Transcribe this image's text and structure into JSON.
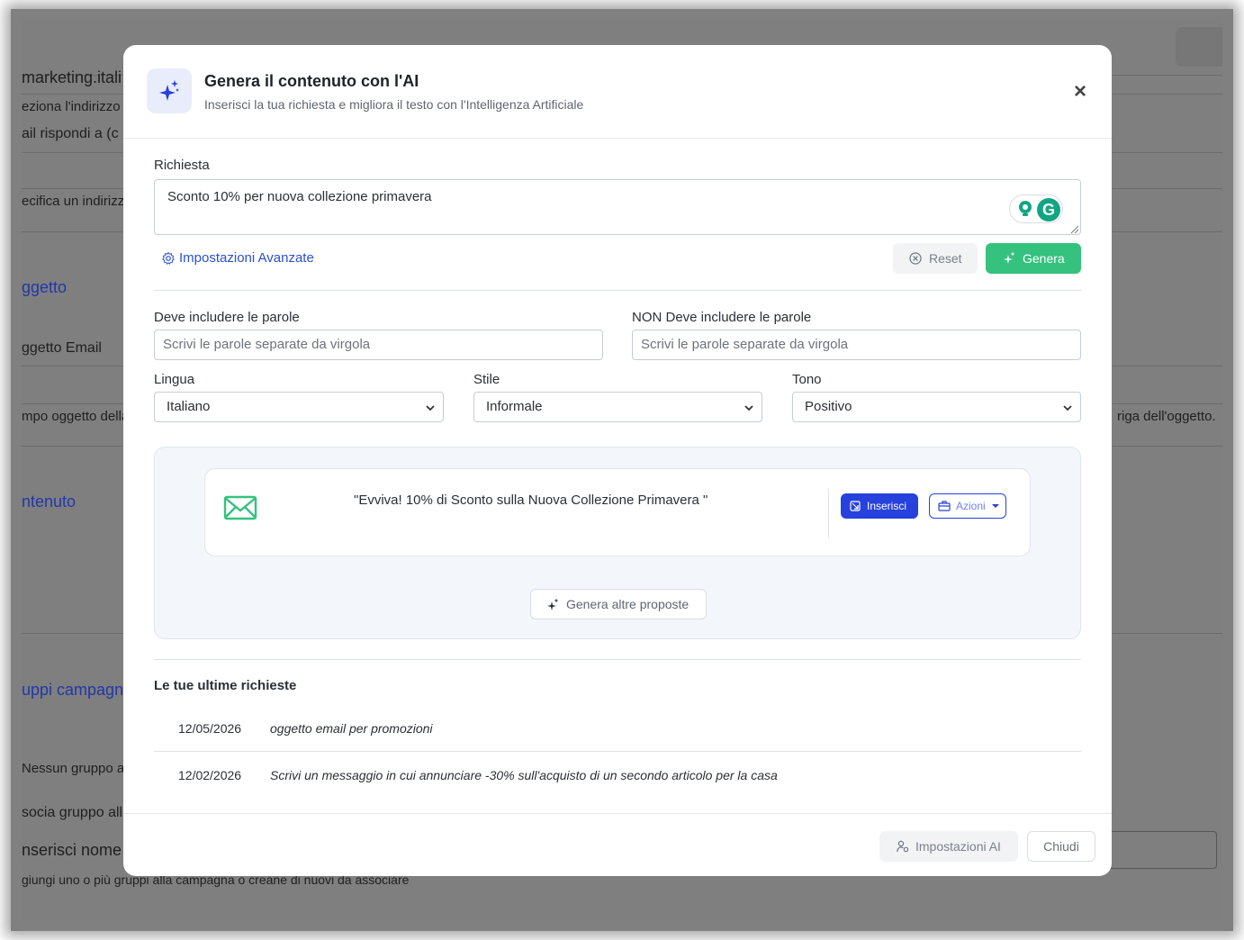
{
  "background": {
    "rows": [
      {
        "text": "marketing.itali",
        "style": "big"
      },
      {
        "text": "eziona l'indirizzo",
        "style": ""
      },
      {
        "text": "ail rispondi a (c",
        "style": "big"
      },
      {
        "text": "ecifica un indirizzo",
        "style": ""
      },
      {
        "text": "ggetto",
        "style": "link"
      },
      {
        "text": "ggetto Email",
        "style": ""
      },
      {
        "text": "mpo oggetto della",
        "style": ""
      },
      {
        "text": "riga dell'oggetto.",
        "style": ""
      },
      {
        "text": "ntenuto",
        "style": "link"
      },
      {
        "text": "uppi campagn",
        "style": "link"
      },
      {
        "text": "Nessun gruppo as",
        "style": ""
      },
      {
        "text": "socia gruppo all",
        "style": ""
      },
      {
        "text": "nserisci nome",
        "style": "big"
      },
      {
        "text": "giungi uno o più gruppi alla campagna o creane di nuovi da associare",
        "style": ""
      }
    ]
  },
  "modal": {
    "title": "Genera il contenuto con l'AI",
    "subtitle": "Inserisci la tua richiesta e migliora il testo con l'Intelligenza Artificiale",
    "close_icon": "close-icon",
    "header_icon": "sparkles-icon"
  },
  "request": {
    "label": "Richiesta",
    "value": "Sconto 10% per nuova collezione primavera",
    "grammarly_letter": "G"
  },
  "actions": {
    "advanced_label": "Impostazioni Avanzate",
    "reset_label": "Reset",
    "generate_label": "Genera",
    "generate_color": "#34c27e"
  },
  "filters": {
    "include_label": "Deve includere le parole",
    "include_placeholder": "Scrivi le parole separate da virgola",
    "exclude_label": "NON Deve includere le parole",
    "exclude_placeholder": "Scrivi le parole separate da virgola",
    "language_label": "Lingua",
    "language_value": "Italiano",
    "style_label": "Stile",
    "style_value": "Informale",
    "tone_label": "Tono",
    "tone_value": "Positivo"
  },
  "proposal": {
    "text": "\"Evviva! 10% di Sconto sulla Nuova Collezione Primavera \"",
    "insert_label": "Inserisci",
    "actions_label": "Azioni",
    "more_label": "Genera altre proposte",
    "accent_color": "#2741dc"
  },
  "history": {
    "title": "Le tue ultime richieste",
    "items": [
      {
        "date": "12/05/2026",
        "query": "oggetto email per promozioni"
      },
      {
        "date": "12/02/2026",
        "query": "Scrivi un messaggio in cui annunciare -30% sull'acquisto di un secondo articolo per la casa"
      }
    ]
  },
  "footer": {
    "ai_settings_label": "Impostazioni AI",
    "close_label": "Chiudi"
  }
}
